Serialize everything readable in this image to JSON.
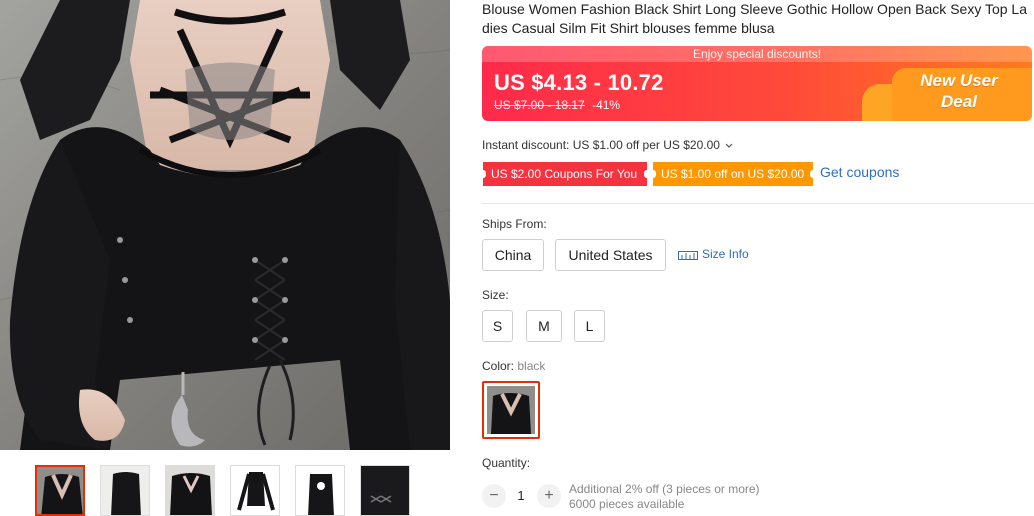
{
  "product": {
    "title": "Blouse Women Fashion Black Shirt Long Sleeve Gothic Hollow Open Back Sexy Top Ladies Casual Silm Fit Shirt blouses femme blusa"
  },
  "price": {
    "banner_top": "Enjoy special discounts!",
    "current": "US $4.13 - 10.72",
    "original": "US $7.00 - 18.17",
    "discount": "-41%",
    "badge_line1": "New User",
    "badge_line2": "Deal",
    "colors": {
      "start": "#ff2a4a",
      "end": "#ff7a1e",
      "badge": "#ff9a1e"
    }
  },
  "discounts": {
    "instant": "Instant discount: US $1.00 off per US $20.00",
    "coupon1": "US $2.00 Coupons For You",
    "coupon2": "US $1.00 off on US $20.00",
    "get_coupons": "Get coupons"
  },
  "ships_from": {
    "label": "Ships From:",
    "options": [
      "China",
      "United States"
    ],
    "size_info": "Size Info"
  },
  "size": {
    "label": "Size:",
    "options": [
      "S",
      "M",
      "L"
    ]
  },
  "color": {
    "label": "Color:",
    "value": "black"
  },
  "quantity": {
    "label": "Quantity:",
    "value": "1",
    "minus": "−",
    "plus": "+",
    "note1": "Additional 2% off (3 pieces or more)",
    "note2": "6000 pieces available"
  },
  "accent": "#e62e04",
  "link_color": "#2e6fc0"
}
